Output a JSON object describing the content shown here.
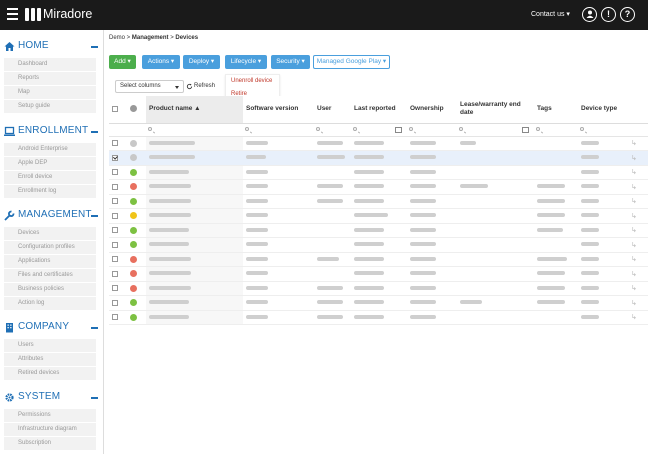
{
  "app": {
    "brand": "Miradore",
    "contact_label": "Contact us ▾"
  },
  "sidebar": {
    "sections": [
      {
        "title": "HOME",
        "icon": "home-icon",
        "items": [
          "Dashboard",
          "Reports",
          "Map",
          "Setup guide"
        ]
      },
      {
        "title": "ENROLLMENT",
        "icon": "laptop-icon",
        "items": [
          "Android Enterprise",
          "Apple DEP",
          "Enroll device",
          "Enrollment log"
        ]
      },
      {
        "title": "MANAGEMENT",
        "icon": "wrench-icon",
        "items": [
          "Devices",
          "Configuration profiles",
          "Applications",
          "Files and certificates",
          "Business policies",
          "Action log"
        ]
      },
      {
        "title": "COMPANY",
        "icon": "building-icon",
        "items": [
          "Users",
          "Attributes",
          "Retired devices"
        ]
      },
      {
        "title": "SYSTEM",
        "icon": "gear-icon",
        "items": [
          "Permissions",
          "Infrastructure diagram",
          "Subscription"
        ]
      }
    ]
  },
  "breadcrumb": {
    "root": "Demo",
    "sep1": " > ",
    "section": "Management",
    "sep2": " > ",
    "page": "Devices"
  },
  "toolbar": {
    "add": "Add ▾",
    "actions": "Actions ▾",
    "deploy": "Deploy ▾",
    "lifecycle": "Lifecycle ▾",
    "security": "Security ▾",
    "managed_play": "Managed Google Play ▾",
    "lifecycle_menu": [
      "Unenroll device",
      "Retire"
    ],
    "select_columns": "Select columns",
    "refresh": "Refresh"
  },
  "table": {
    "columns": [
      "Product name ▲",
      "Software version",
      "User",
      "Last reported",
      "Ownership",
      "Lease/warranty end date",
      "Tags",
      "Device type"
    ],
    "status_colors": {
      "gray": "#c8c8c8",
      "green": "#7dc142",
      "red": "#e8705f",
      "yellow": "#f0c419"
    },
    "rows": [
      {
        "status": "gray",
        "checked": false,
        "selected": false,
        "w": [
          46,
          22,
          26,
          30,
          26,
          16,
          0,
          18
        ]
      },
      {
        "status": "gray",
        "checked": true,
        "selected": true,
        "w": [
          46,
          20,
          28,
          30,
          26,
          0,
          0,
          18
        ]
      },
      {
        "status": "green",
        "checked": false,
        "selected": false,
        "w": [
          40,
          22,
          0,
          30,
          26,
          0,
          0,
          18
        ]
      },
      {
        "status": "red",
        "checked": false,
        "selected": false,
        "w": [
          42,
          22,
          26,
          30,
          26,
          28,
          28,
          18
        ]
      },
      {
        "status": "green",
        "checked": false,
        "selected": false,
        "w": [
          42,
          22,
          26,
          30,
          26,
          0,
          28,
          18
        ]
      },
      {
        "status": "yellow",
        "checked": false,
        "selected": false,
        "w": [
          42,
          22,
          0,
          34,
          26,
          0,
          28,
          18
        ]
      },
      {
        "status": "green",
        "checked": false,
        "selected": false,
        "w": [
          40,
          22,
          0,
          30,
          26,
          0,
          26,
          18
        ]
      },
      {
        "status": "green",
        "checked": false,
        "selected": false,
        "w": [
          40,
          22,
          0,
          30,
          26,
          0,
          0,
          18
        ]
      },
      {
        "status": "red",
        "checked": false,
        "selected": false,
        "w": [
          42,
          22,
          22,
          30,
          26,
          0,
          30,
          18
        ]
      },
      {
        "status": "red",
        "checked": false,
        "selected": false,
        "w": [
          42,
          22,
          0,
          30,
          26,
          0,
          28,
          18
        ]
      },
      {
        "status": "red",
        "checked": false,
        "selected": false,
        "w": [
          42,
          22,
          26,
          30,
          26,
          0,
          28,
          18
        ]
      },
      {
        "status": "green",
        "checked": false,
        "selected": false,
        "w": [
          40,
          22,
          26,
          30,
          26,
          22,
          28,
          18
        ]
      },
      {
        "status": "green",
        "checked": false,
        "selected": false,
        "w": [
          40,
          22,
          26,
          30,
          26,
          0,
          0,
          18
        ]
      }
    ]
  }
}
